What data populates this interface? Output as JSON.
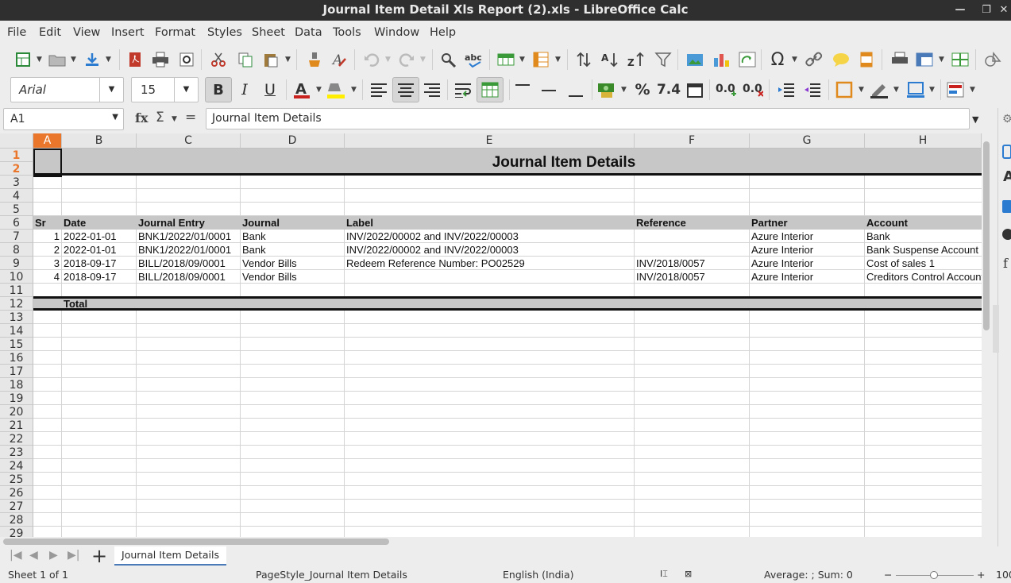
{
  "window": {
    "title": "Journal Item Detail Xls Report (2).xls - LibreOffice Calc"
  },
  "menu": [
    "File",
    "Edit",
    "View",
    "Insert",
    "Format",
    "Styles",
    "Sheet",
    "Data",
    "Tools",
    "Window",
    "Help"
  ],
  "format_bar": {
    "font_name": "Arial",
    "font_size": "15"
  },
  "formula_bar": {
    "cell_ref": "A1",
    "content": "Journal Item Details",
    "fx": "fx",
    "sigma": "Σ",
    "equals": "="
  },
  "columns": [
    "A",
    "B",
    "C",
    "D",
    "E",
    "F",
    "G",
    "H"
  ],
  "rows": [
    "1",
    "2",
    "3",
    "4",
    "5",
    "6",
    "7",
    "8",
    "9",
    "10",
    "11",
    "12",
    "13",
    "14",
    "15",
    "16",
    "17",
    "18",
    "19",
    "20",
    "21",
    "22",
    "23",
    "24",
    "25",
    "26",
    "27",
    "28",
    "29"
  ],
  "report": {
    "title": "Journal Item Details",
    "headers": [
      "Sr",
      "Date",
      "Journal Entry",
      "Journal",
      "Label",
      "Reference",
      "Partner",
      "Account"
    ],
    "rows": [
      [
        "1",
        "2022-01-01",
        "BNK1/2022/01/0001",
        "Bank",
        "INV/2022/00002 and INV/2022/00003",
        "",
        "Azure Interior",
        "Bank"
      ],
      [
        "2",
        "2022-01-01",
        "BNK1/2022/01/0001",
        "Bank",
        "INV/2022/00002 and INV/2022/00003",
        "",
        "Azure Interior",
        "Bank Suspense Account"
      ],
      [
        "3",
        "2018-09-17",
        "BILL/2018/09/0001",
        "Vendor Bills",
        "Redeem Reference Number: PO02529",
        "INV/2018/0057",
        "Azure Interior",
        "Cost of sales 1"
      ],
      [
        "4",
        "2018-09-17",
        "BILL/2018/09/0001",
        "Vendor Bills",
        "",
        "INV/2018/0057",
        "Azure Interior",
        "Creditors Control Account"
      ]
    ],
    "total_label": "Total"
  },
  "sheet_tabs": [
    "Journal Item Details"
  ],
  "status": {
    "sheet": "Sheet 1 of 1",
    "page_style": "PageStyle_Journal Item Details",
    "language": "English (India)",
    "summary": "Average: ; Sum: 0",
    "zoom": "100"
  }
}
